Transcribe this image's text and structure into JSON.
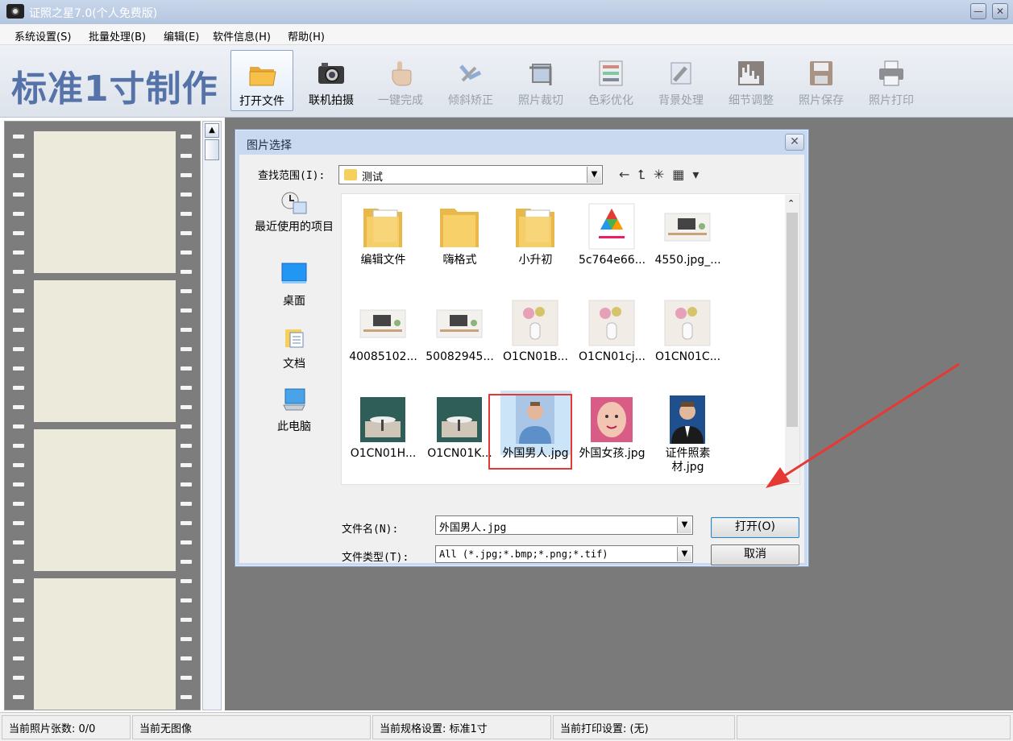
{
  "window": {
    "title": "证照之星7.0(个人免费版)",
    "min_symbol": "—",
    "close_symbol": "✕"
  },
  "menu": [
    "系统设置(S)",
    "批量处理(B)",
    "编辑(E)",
    "软件信息(H)",
    "帮助(H)"
  ],
  "toolbar": {
    "big_title": "标准1寸制作",
    "tools": [
      {
        "label": "打开文件",
        "icon": "open-folder-icon",
        "state": "active"
      },
      {
        "label": "联机拍摄",
        "icon": "camera-icon",
        "state": "enabled"
      },
      {
        "label": "一键完成",
        "icon": "hand-pointer-icon",
        "state": "disabled"
      },
      {
        "label": "倾斜矫正",
        "icon": "rotate-arrows-icon",
        "state": "disabled"
      },
      {
        "label": "照片裁切",
        "icon": "crop-icon",
        "state": "disabled"
      },
      {
        "label": "色彩优化",
        "icon": "color-sliders-icon",
        "state": "disabled"
      },
      {
        "label": "背景处理",
        "icon": "brush-icon",
        "state": "disabled"
      },
      {
        "label": "细节调整",
        "icon": "histogram-icon",
        "state": "disabled"
      },
      {
        "label": "照片保存",
        "icon": "floppy-disk-icon",
        "state": "disabled"
      },
      {
        "label": "照片打印",
        "icon": "printer-icon",
        "state": "disabled"
      }
    ]
  },
  "dialog": {
    "title": "图片选择",
    "close_symbol": "✕",
    "lookin_label": "查找范围(I):",
    "lookin_value": "测试",
    "places": [
      "最近使用的项目",
      "桌面",
      "文档",
      "此电脑"
    ],
    "files": [
      {
        "name": "编辑文件",
        "kind": "folder-docs"
      },
      {
        "name": "嗨格式",
        "kind": "folder"
      },
      {
        "name": "小升初",
        "kind": "folder-docs"
      },
      {
        "name": "5c764e66...",
        "kind": "image-logo"
      },
      {
        "name": "4550.jpg_...",
        "kind": "image-desk"
      },
      {
        "name": "40085102...",
        "kind": "image-desk"
      },
      {
        "name": "50082945...",
        "kind": "image-desk"
      },
      {
        "name": "O1CN01B...",
        "kind": "image-vase"
      },
      {
        "name": "O1CN01cj...",
        "kind": "image-vase"
      },
      {
        "name": "O1CN01C...",
        "kind": "image-vase"
      },
      {
        "name": "O1CN01H...",
        "kind": "image-room"
      },
      {
        "name": "O1CN01K...",
        "kind": "image-room"
      },
      {
        "name": "外国男人.jpg",
        "kind": "image-portrait-blue",
        "selected": true
      },
      {
        "name": "外国女孩.jpg",
        "kind": "image-portrait-pink"
      },
      {
        "name": "证件照素材.jpg",
        "kind": "image-portrait-suit"
      }
    ],
    "filename_label": "文件名(N):",
    "filename_value": "外国男人.jpg",
    "filetype_label": "文件类型(T):",
    "filetype_value": "All (*.jpg;*.bmp;*.png;*.tif)",
    "open_button": "打开(O)",
    "cancel_button": "取消"
  },
  "status": [
    "当前照片张数: 0/0",
    "当前无图像",
    "当前规格设置: 标准1寸",
    "当前打印设置: (无)",
    ""
  ],
  "colors": {
    "title_accent": "#5573a8",
    "selection_border": "#e53935",
    "annotation_arrow": "#e53935"
  }
}
